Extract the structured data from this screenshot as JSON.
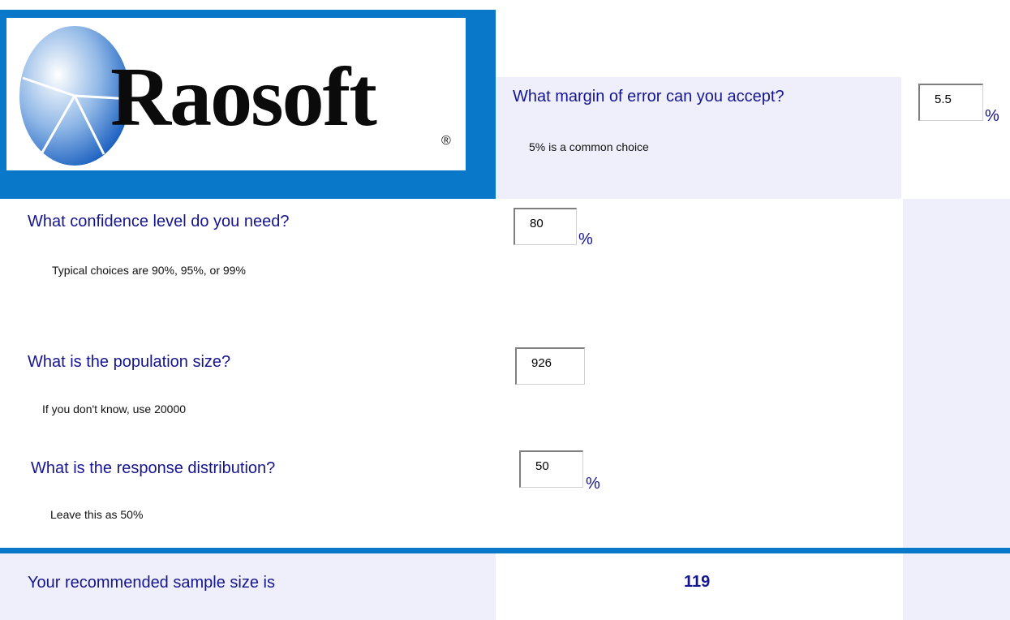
{
  "logo": {
    "brand": "Raosoft",
    "registered_mark": "®"
  },
  "margin_of_error": {
    "question": "What margin of error can you accept?",
    "hint": "5% is a common choice",
    "value": "5.5",
    "unit": "%"
  },
  "confidence_level": {
    "question": "What confidence level do you need?",
    "hint": "Typical choices are 90%, 95%, or 99%",
    "value": "80",
    "unit": "%"
  },
  "population_size": {
    "question": "What is the population size?",
    "hint": "If you don't know, use 20000",
    "value": "926"
  },
  "response_distribution": {
    "question": "What is the response distribution?",
    "hint": "Leave this as 50%",
    "value": "50",
    "unit": "%"
  },
  "result": {
    "label": "Your recommended sample size is",
    "value": "119"
  },
  "colors": {
    "accent_blue": "#0a78c8",
    "panel_lavender": "#efeffb",
    "text_navy": "#15158f"
  }
}
